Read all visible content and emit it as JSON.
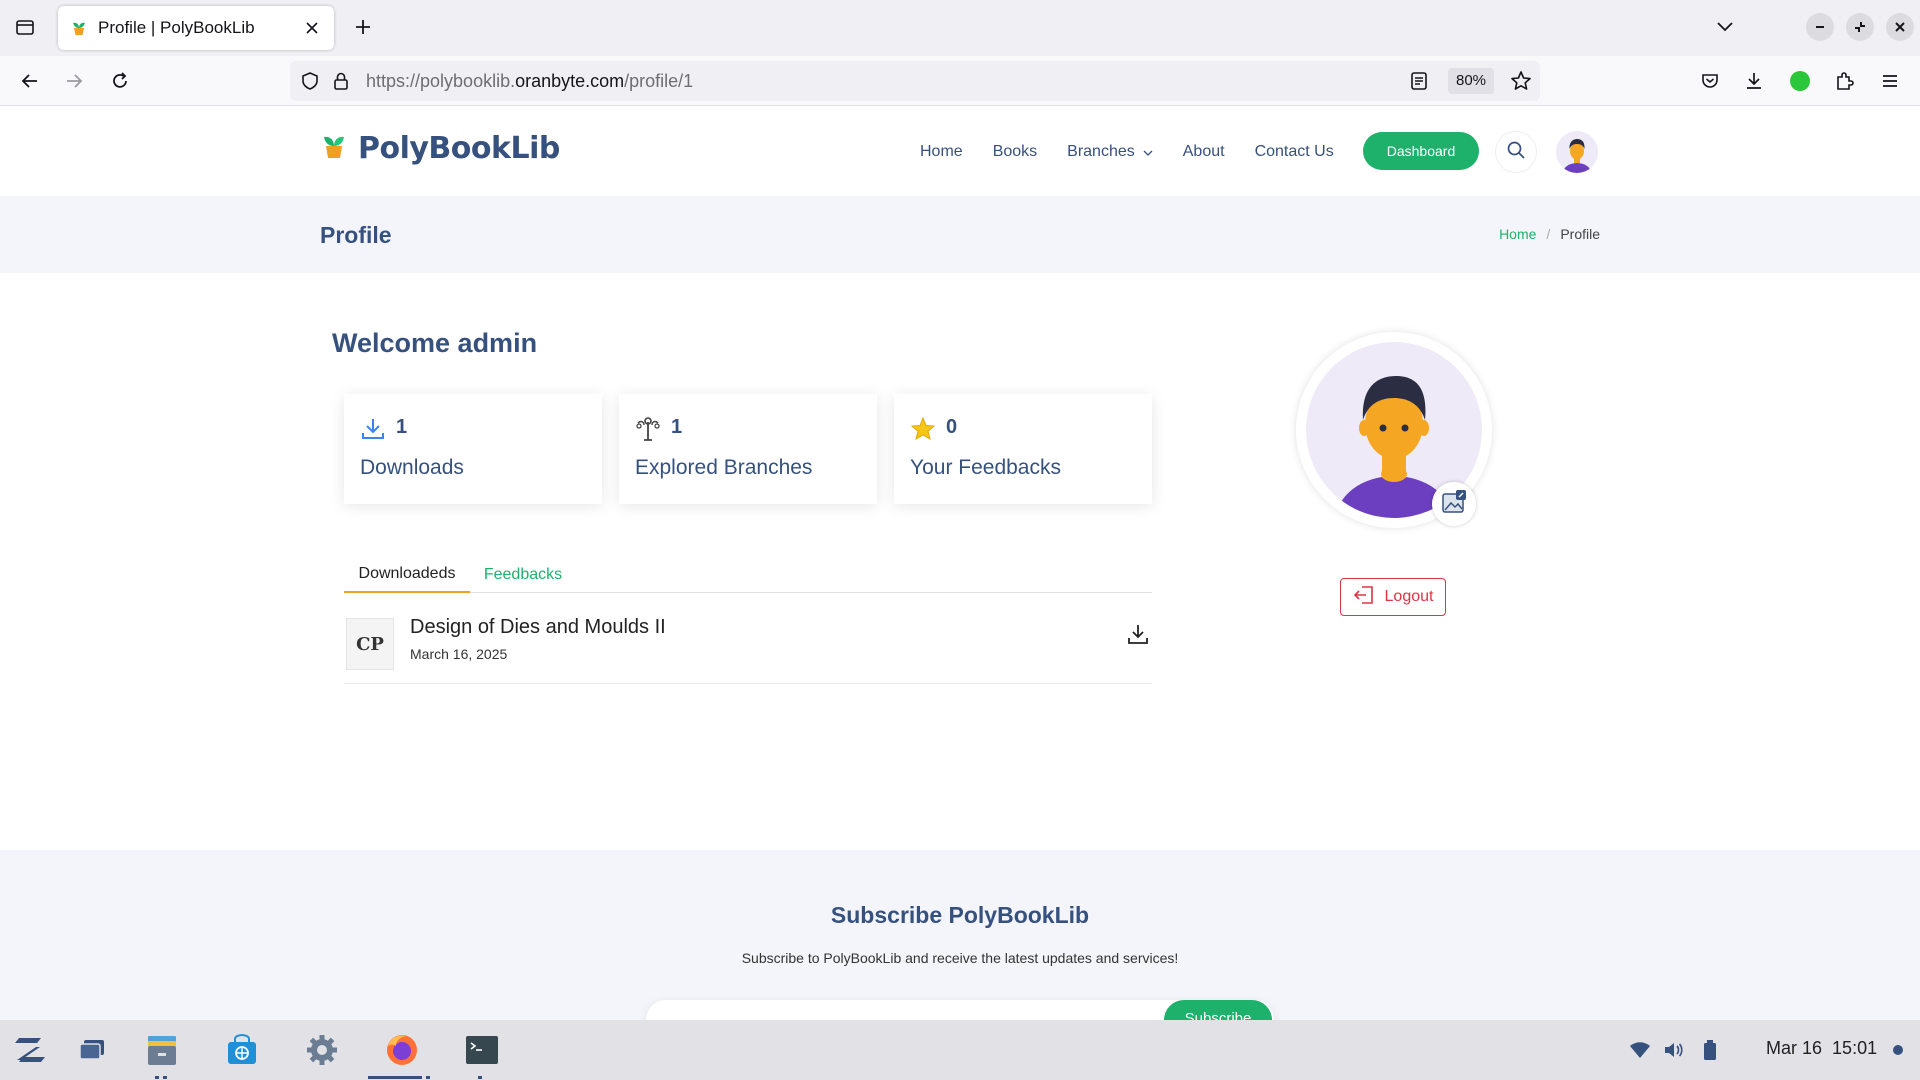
{
  "browser": {
    "tab_title": "Profile | PolyBookLib",
    "url_prefix": "https://polybooklib.",
    "url_domain": "oranbyte.com",
    "url_path": "/profile/1",
    "zoom": "80%"
  },
  "site": {
    "brand": "PolyBookLib",
    "menu": {
      "home": "Home",
      "books": "Books",
      "branches": "Branches",
      "about": "About",
      "contact": "Contact Us"
    },
    "dashboard_button": "Dashboard"
  },
  "breadcrumb": {
    "page_title": "Profile",
    "home": "Home",
    "separator": "/",
    "current": "Profile"
  },
  "profile": {
    "welcome": "Welcome admin",
    "stats": [
      {
        "value": "1",
        "label": "Downloads",
        "icon": "download-icon"
      },
      {
        "value": "1",
        "label": "Explored Branches",
        "icon": "branch-icon"
      },
      {
        "value": "0",
        "label": "Your Feedbacks",
        "icon": "star-icon"
      }
    ],
    "tabs": [
      "Downloadeds",
      "Feedbacks"
    ],
    "downloads": [
      {
        "thumb": "CP",
        "title": "Design of Dies and Moulds II",
        "date": "March 16, 2025"
      }
    ],
    "logout_label": "Logout"
  },
  "subscribe": {
    "title": "Subscribe PolyBookLib",
    "text": "Subscribe to PolyBookLib and receive the latest updates and services!",
    "button": "Subscribe"
  },
  "taskbar": {
    "date": "Mar 16",
    "time": "15:01"
  },
  "colors": {
    "brand": "#37517e",
    "accent": "#1eb16b",
    "danger": "#dc3545",
    "tab_active": "#f0a020"
  }
}
